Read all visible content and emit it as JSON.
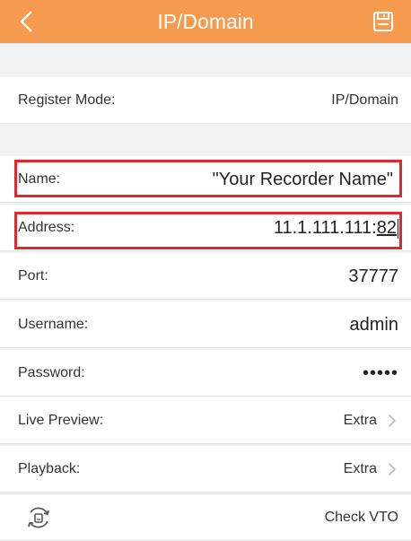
{
  "header": {
    "title": "IP/Domain",
    "background": "#f59a4f"
  },
  "icons": {
    "back": "back-arrow-icon",
    "save": "save-disk-icon",
    "chevron": "chevron-right-icon",
    "sync": "rotate-sync-icon"
  },
  "register_mode": {
    "label": "Register Mode:",
    "value": "IP/Domain"
  },
  "name": {
    "label": "Name:",
    "value": "\"Your Recorder Name\""
  },
  "address": {
    "label": "Address:",
    "value_main": "11.1.111.111:",
    "value_port": "82"
  },
  "port": {
    "label": "Port:",
    "value": "37777"
  },
  "username": {
    "label": "Username:",
    "value": "admin"
  },
  "password": {
    "label": "Password:",
    "value": "•••••"
  },
  "live_preview": {
    "label": "Live Preview:",
    "value": "Extra"
  },
  "playback": {
    "label": "Playback:",
    "value": "Extra"
  },
  "footer": {
    "check_label": "Check VTO"
  },
  "highlight_color": "#e0262f"
}
